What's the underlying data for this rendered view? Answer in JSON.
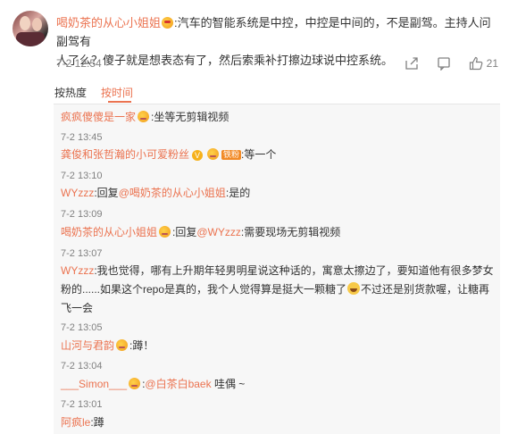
{
  "main": {
    "username": "喝奶茶的从心小姐姐",
    "text_lines": [
      ":汽车的智能系统是中控，中控是中间的，不是副驾。主持人问副驾有",
      "人了么？傻子就是想表态有了，然后索乘补打擦边球说中控系统。"
    ],
    "time": "7-2 12:54",
    "like_count": "21"
  },
  "sort": {
    "label": "按热度",
    "active": "按时间"
  },
  "replies": [
    {
      "user": "疯疯傻傻是一家",
      "text": ":坐等无剪辑视频",
      "time": "7-2 13:45"
    },
    {
      "user": "龚俊和张哲瀚的小可爱粉丝",
      "tag": "铁粉",
      "text": ":等一个",
      "time": "7-2 13:10"
    },
    {
      "user": "WYzzz",
      "text": ":回复",
      "mention": "@喝奶茶的从心小姐姐",
      "text2": ":是的",
      "time": "7-2 13:09"
    },
    {
      "user": "喝奶茶的从心小姐姐",
      "text": ":回复",
      "mention": "@WYzzz",
      "text2": ":需要现场无剪辑视频",
      "time": "7-2 13:07"
    },
    {
      "user": "WYzzz",
      "lines": [
        ":我也觉得，哪有上升期年轻男明星说这种话的，寓意太擦边了，要知道他有很多梦女",
        "粉的......如果这个repo是真的，我个人觉得算是挺大一颗糖了",
        "不过还是别货款喔，让糖再",
        "飞一会"
      ],
      "time": "7-2 13:05"
    },
    {
      "user": "山河与君韵",
      "text": ":蹲！",
      "time": "7-2 13:04"
    },
    {
      "user": "___Simon___",
      "text": ":",
      "mention": "@白茶白baek",
      "text2": " 哇偶 ~",
      "time": "7-2 13:01"
    },
    {
      "user": "阿疯le",
      "text": ":蹲",
      "time": ""
    }
  ],
  "colors": {
    "accent": "#eb7350",
    "meta": "#808080",
    "subbg": "#f7f7f7"
  },
  "icons": [
    "share-icon",
    "comment-icon",
    "like-icon",
    "emoji-badge-icon",
    "verified-icon"
  ]
}
